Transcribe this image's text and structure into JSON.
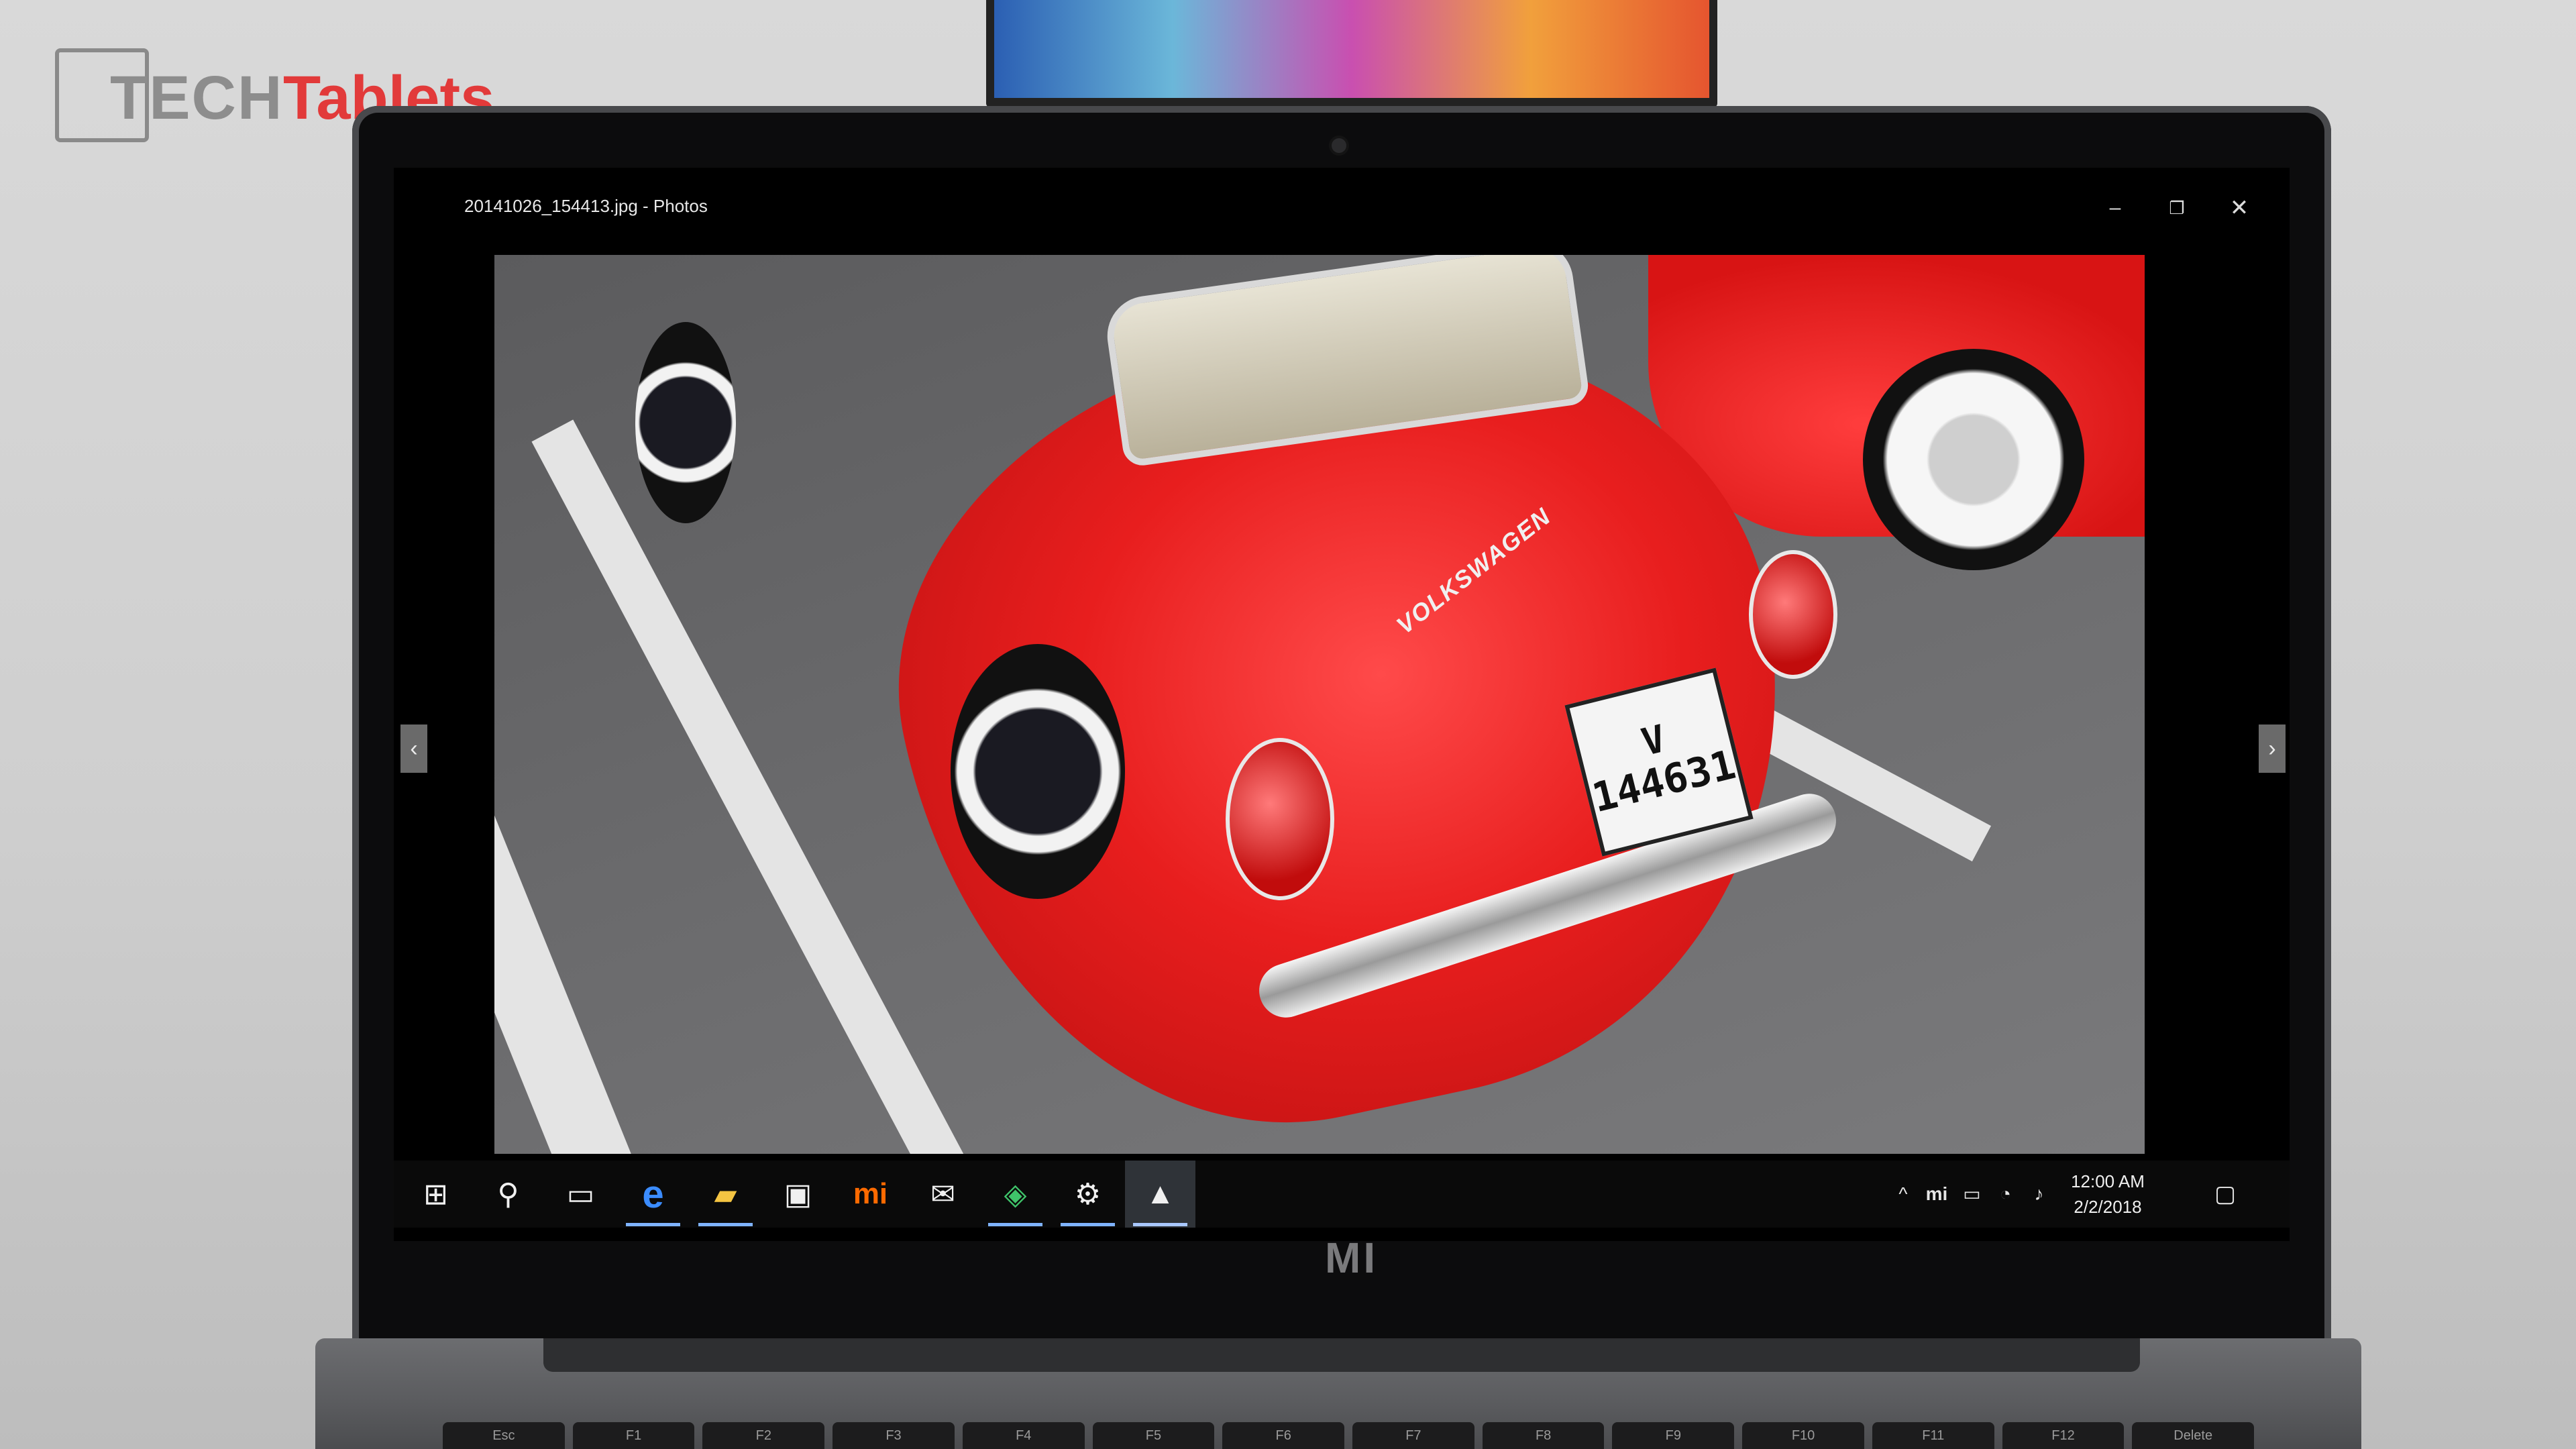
{
  "watermark": {
    "part1": "TECH",
    "part2": "Tablets"
  },
  "laptop": {
    "brand": "MI"
  },
  "keyboard": {
    "keys": [
      "Esc",
      "F1",
      "F2",
      "F3",
      "F4",
      "F5",
      "F6",
      "F7",
      "F8",
      "F9",
      "F10",
      "F11",
      "F12",
      "Delete"
    ]
  },
  "window": {
    "title": "20141026_154413.jpg - Photos",
    "minimize_glyph": "–",
    "maximize_glyph": "❐",
    "close_glyph": "✕"
  },
  "photo": {
    "plate_line1": "V",
    "plate_line2": "144631",
    "badge": "VOLKSWAGEN"
  },
  "nav": {
    "prev_glyph": "‹",
    "next_glyph": "›"
  },
  "taskbar": {
    "items": [
      {
        "name": "start-button",
        "icon": "windows-logo-icon",
        "glyph": "⊞"
      },
      {
        "name": "search-button",
        "icon": "search-icon",
        "glyph": "⚲"
      },
      {
        "name": "task-view-button",
        "icon": "task-view-icon",
        "glyph": "▭"
      },
      {
        "name": "edge-button",
        "icon": "edge-icon",
        "glyph": "e"
      },
      {
        "name": "file-explorer-button",
        "icon": "folder-icon",
        "glyph": "▰"
      },
      {
        "name": "store-button",
        "icon": "store-icon",
        "glyph": "▣"
      },
      {
        "name": "mi-app-button",
        "icon": "mi-icon",
        "glyph": "mi"
      },
      {
        "name": "mail-button",
        "icon": "mail-icon",
        "glyph": "✉"
      },
      {
        "name": "app-green-button",
        "icon": "green-app-icon",
        "glyph": "◈"
      },
      {
        "name": "settings-button",
        "icon": "gear-icon",
        "glyph": "⚙"
      },
      {
        "name": "photos-button",
        "icon": "photos-icon",
        "glyph": "▲"
      }
    ],
    "tray": {
      "chevron": "^",
      "mi_glyph": "mi",
      "battery_glyph": "▭",
      "wifi_glyph": "◔",
      "volume_glyph": "♪",
      "notification_glyph": "▢"
    },
    "clock": {
      "time": "12:00 AM",
      "date": "2/2/2018"
    }
  },
  "colors": {
    "taskbar_accent": "#7fb3ff",
    "car_red": "#e81e1e",
    "watermark_red": "#e23a3a"
  }
}
